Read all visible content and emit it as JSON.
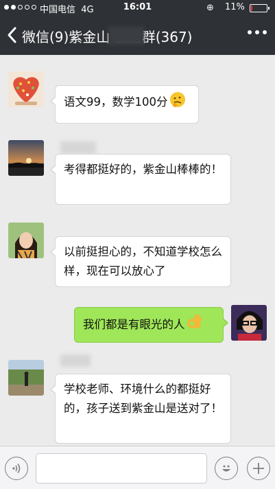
{
  "status_bar": {
    "carrier": "中国电信",
    "network": "4G",
    "time": "16:01",
    "battery": "11%",
    "battery_level": 0.11
  },
  "nav": {
    "back_label": "微信(9)",
    "title": "紫金山  业主群",
    "count": "(367)"
  },
  "messages": [
    {
      "side": "left",
      "text": "语文99，数学100分",
      "emoji": "thinking-face-icon"
    },
    {
      "side": "left",
      "text": "考得都挺好的，紫金山棒棒的！"
    },
    {
      "side": "left",
      "text": "以前挺担心的，不知道学校怎么样，现在可以放心了"
    },
    {
      "side": "right",
      "text": "我们都是有眼光的人",
      "emoji": "ok-hand-icon"
    },
    {
      "side": "left",
      "text": "学校老师、环境什么的都挺好的，孩子送到紫金山是送对了！"
    }
  ],
  "input": {
    "value": "",
    "placeholder": ""
  }
}
